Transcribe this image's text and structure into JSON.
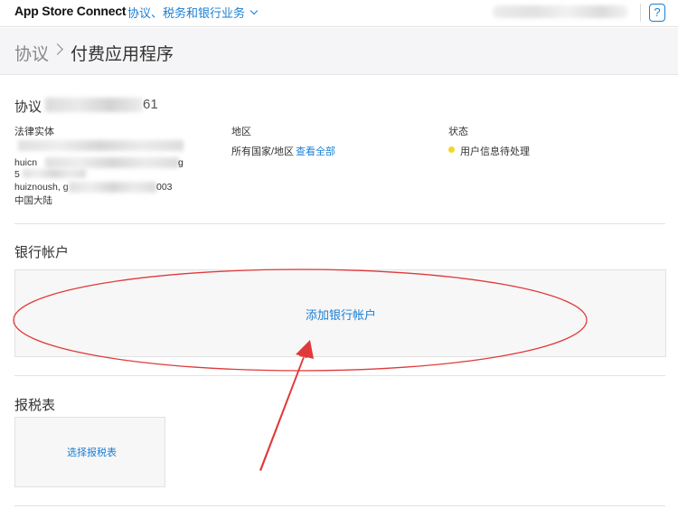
{
  "topnav": {
    "brand": "App Store Connect",
    "menu_label": "协议、税务和银行业务",
    "help_label": "?"
  },
  "breadcrumb": {
    "root": "协议",
    "current": "付费应用程序"
  },
  "agreement": {
    "title_prefix": "协议",
    "title_suffix": "61",
    "legal_entity_label": "法律实体",
    "entity_lines": [
      "huicn",
      "5",
      "huiznoush, g",
      "中国大陆"
    ],
    "entity_line_suffix": "g",
    "entity_line3_suffix": "003",
    "region_label": "地区",
    "region_value": "所有国家/地区",
    "view_all": "查看全部",
    "status_label": "状态",
    "status_value": "用户信息待处理",
    "status_color": "#f0d72b"
  },
  "bank": {
    "title": "银行帐户",
    "add_label": "添加银行帐户"
  },
  "tax": {
    "title": "报税表",
    "select_label": "选择报税表"
  },
  "colors": {
    "accent": "#1a7fd4",
    "annotation": "#e0393a"
  }
}
